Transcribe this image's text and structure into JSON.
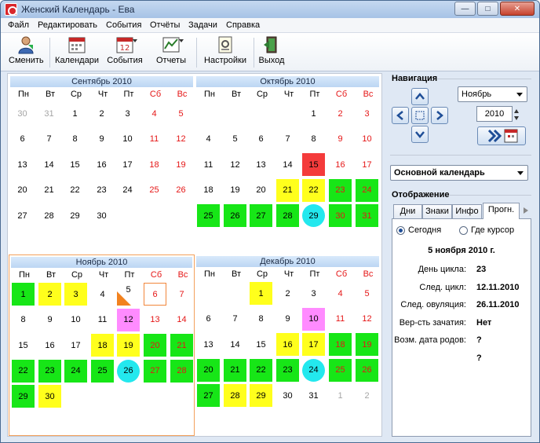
{
  "window": {
    "title": "Женский Календарь - Ева",
    "minimize_icon": "minimize-icon",
    "maximize_icon": "maximize-icon",
    "close_icon": "close-icon"
  },
  "menu": [
    "Файл",
    "Редактировать",
    "События",
    "Отчёты",
    "Задачи",
    "Справка"
  ],
  "toolbar": {
    "change": "Сменить",
    "calendars": "Календари",
    "events": "События",
    "reports": "Отчеты",
    "settings": "Настройки",
    "exit": "Выход"
  },
  "weekdays": [
    "Пн",
    "Вт",
    "Ср",
    "Чт",
    "Пт",
    "Сб",
    "Вс"
  ],
  "months": [
    {
      "title": "Сентябрь 2010",
      "selected": false,
      "weeks": [
        [
          {
            "d": "30",
            "c": "other"
          },
          {
            "d": "31",
            "c": "other"
          },
          {
            "d": "1"
          },
          {
            "d": "2"
          },
          {
            "d": "3"
          },
          {
            "d": "4",
            "c": "weekend"
          },
          {
            "d": "5",
            "c": "weekend"
          }
        ],
        [
          {
            "d": "6"
          },
          {
            "d": "7"
          },
          {
            "d": "8"
          },
          {
            "d": "9"
          },
          {
            "d": "10"
          },
          {
            "d": "11",
            "c": "weekend"
          },
          {
            "d": "12",
            "c": "weekend"
          }
        ],
        [
          {
            "d": "13"
          },
          {
            "d": "14"
          },
          {
            "d": "15"
          },
          {
            "d": "16"
          },
          {
            "d": "17"
          },
          {
            "d": "18",
            "c": "weekend"
          },
          {
            "d": "19",
            "c": "weekend"
          }
        ],
        [
          {
            "d": "20"
          },
          {
            "d": "21"
          },
          {
            "d": "22"
          },
          {
            "d": "23"
          },
          {
            "d": "24"
          },
          {
            "d": "25",
            "c": "weekend"
          },
          {
            "d": "26",
            "c": "weekend"
          }
        ],
        [
          {
            "d": "27"
          },
          {
            "d": "28"
          },
          {
            "d": "29"
          },
          {
            "d": "30"
          },
          {
            "d": ""
          },
          {
            "d": ""
          },
          {
            "d": ""
          }
        ]
      ]
    },
    {
      "title": "Октябрь 2010",
      "selected": false,
      "weeks": [
        [
          {
            "d": ""
          },
          {
            "d": ""
          },
          {
            "d": ""
          },
          {
            "d": ""
          },
          {
            "d": "1"
          },
          {
            "d": "2",
            "c": "weekend"
          },
          {
            "d": "3",
            "c": "weekend"
          }
        ],
        [
          {
            "d": "4"
          },
          {
            "d": "5"
          },
          {
            "d": "6"
          },
          {
            "d": "7"
          },
          {
            "d": "8"
          },
          {
            "d": "9",
            "c": "weekend"
          },
          {
            "d": "10",
            "c": "weekend"
          }
        ],
        [
          {
            "d": "11"
          },
          {
            "d": "12"
          },
          {
            "d": "13"
          },
          {
            "d": "14"
          },
          {
            "d": "15",
            "c": "red"
          },
          {
            "d": "16",
            "c": "weekend"
          },
          {
            "d": "17",
            "c": "weekend"
          }
        ],
        [
          {
            "d": "18"
          },
          {
            "d": "19"
          },
          {
            "d": "20"
          },
          {
            "d": "21",
            "c": "yellow"
          },
          {
            "d": "22",
            "c": "yellow"
          },
          {
            "d": "23",
            "c": "green weekend"
          },
          {
            "d": "24",
            "c": "green weekend"
          }
        ],
        [
          {
            "d": "25",
            "c": "green"
          },
          {
            "d": "26",
            "c": "green"
          },
          {
            "d": "27",
            "c": "green"
          },
          {
            "d": "28",
            "c": "green"
          },
          {
            "d": "29",
            "c": "cyan"
          },
          {
            "d": "30",
            "c": "green weekend"
          },
          {
            "d": "31",
            "c": "green weekend"
          }
        ]
      ]
    },
    {
      "title": "Ноябрь 2010",
      "selected": true,
      "weeks": [
        [
          {
            "d": "1",
            "c": "green"
          },
          {
            "d": "2",
            "c": "yellow"
          },
          {
            "d": "3",
            "c": "yellow"
          },
          {
            "d": "4"
          },
          {
            "d": "5",
            "c": "tri"
          },
          {
            "d": "6",
            "c": "today weekend"
          },
          {
            "d": "7",
            "c": "weekend"
          }
        ],
        [
          {
            "d": "8"
          },
          {
            "d": "9"
          },
          {
            "d": "10"
          },
          {
            "d": "11"
          },
          {
            "d": "12",
            "c": "pink"
          },
          {
            "d": "13",
            "c": "weekend"
          },
          {
            "d": "14",
            "c": "weekend"
          }
        ],
        [
          {
            "d": "15"
          },
          {
            "d": "16"
          },
          {
            "d": "17"
          },
          {
            "d": "18",
            "c": "yellow"
          },
          {
            "d": "19",
            "c": "yellow"
          },
          {
            "d": "20",
            "c": "green weekend"
          },
          {
            "d": "21",
            "c": "green weekend"
          }
        ],
        [
          {
            "d": "22",
            "c": "green"
          },
          {
            "d": "23",
            "c": "green"
          },
          {
            "d": "24",
            "c": "green"
          },
          {
            "d": "25",
            "c": "green"
          },
          {
            "d": "26",
            "c": "cyan"
          },
          {
            "d": "27",
            "c": "green weekend"
          },
          {
            "d": "28",
            "c": "green weekend"
          }
        ],
        [
          {
            "d": "29",
            "c": "green"
          },
          {
            "d": "30",
            "c": "yellow"
          },
          {
            "d": ""
          },
          {
            "d": ""
          },
          {
            "d": ""
          },
          {
            "d": ""
          },
          {
            "d": ""
          }
        ]
      ]
    },
    {
      "title": "Декабрь 2010",
      "selected": false,
      "weeks": [
        [
          {
            "d": ""
          },
          {
            "d": ""
          },
          {
            "d": "1",
            "c": "yellow"
          },
          {
            "d": "2"
          },
          {
            "d": "3"
          },
          {
            "d": "4",
            "c": "weekend"
          },
          {
            "d": "5",
            "c": "weekend"
          }
        ],
        [
          {
            "d": "6"
          },
          {
            "d": "7"
          },
          {
            "d": "8"
          },
          {
            "d": "9"
          },
          {
            "d": "10",
            "c": "pink"
          },
          {
            "d": "11",
            "c": "weekend"
          },
          {
            "d": "12",
            "c": "weekend"
          }
        ],
        [
          {
            "d": "13"
          },
          {
            "d": "14"
          },
          {
            "d": "15"
          },
          {
            "d": "16",
            "c": "yellow"
          },
          {
            "d": "17",
            "c": "yellow"
          },
          {
            "d": "18",
            "c": "green weekend"
          },
          {
            "d": "19",
            "c": "green weekend"
          }
        ],
        [
          {
            "d": "20",
            "c": "green"
          },
          {
            "d": "21",
            "c": "green"
          },
          {
            "d": "22",
            "c": "green"
          },
          {
            "d": "23",
            "c": "green"
          },
          {
            "d": "24",
            "c": "cyan"
          },
          {
            "d": "25",
            "c": "green weekend"
          },
          {
            "d": "26",
            "c": "green weekend"
          }
        ],
        [
          {
            "d": "27",
            "c": "green"
          },
          {
            "d": "28",
            "c": "yellow"
          },
          {
            "d": "29",
            "c": "yellow"
          },
          {
            "d": "30"
          },
          {
            "d": "31"
          },
          {
            "d": "1",
            "c": "other"
          },
          {
            "d": "2",
            "c": "other"
          }
        ]
      ]
    }
  ],
  "navigation": {
    "title": "Навигация",
    "month_value": "Ноябрь",
    "year_value": "2010"
  },
  "calendar_select": "Основной календарь",
  "display": {
    "title": "Отображение",
    "tabs": [
      "Дни",
      "Знаки",
      "Инфо",
      "Прогн."
    ],
    "radio_today": "Сегодня",
    "radio_cursor": "Где курсор",
    "date": "5 ноября 2010 г.",
    "rows": [
      {
        "label": "День цикла:",
        "value": "23"
      },
      {
        "label": "След. цикл:",
        "value": "12.11.2010"
      },
      {
        "label": "След. овуляция:",
        "value": "26.11.2010"
      },
      {
        "label": "Вер-сть зачатия:",
        "value": "Нет"
      },
      {
        "label": "Возм. дата родов:",
        "value": "?"
      },
      {
        "label": "",
        "value": "?"
      }
    ]
  },
  "colors": {
    "green": "#17e617",
    "yellow": "#ffff1c",
    "red": "#f43b3b",
    "pink": "#ff8bff",
    "cyan": "#23e8ee",
    "weekend": "#e51616",
    "selection": "#f3a05b"
  }
}
